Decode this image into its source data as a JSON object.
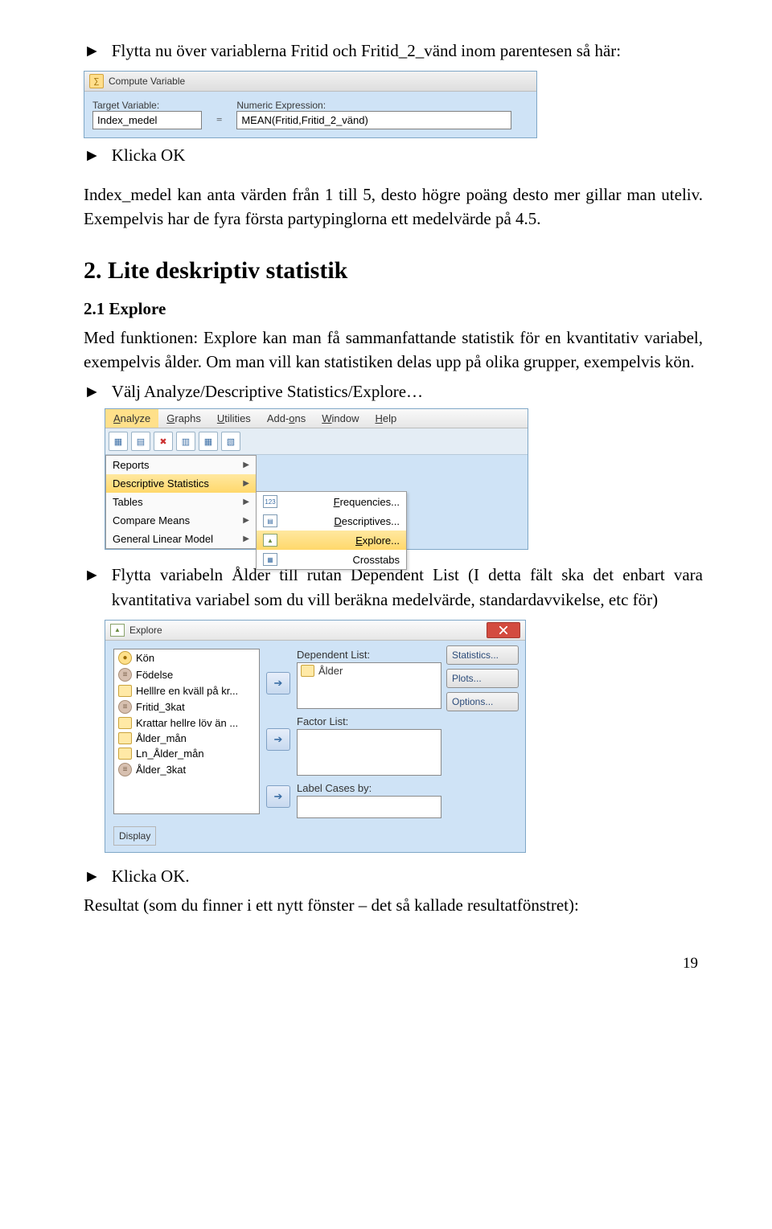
{
  "p1_prefix": "► ",
  "p1": "Flytta nu över variablerna Fritid och Fritid_2_vänd inom parentesen så här:",
  "compute": {
    "title": "Compute Variable",
    "target_label": "Target Variable:",
    "target_value": "Index_medel",
    "eq": "=",
    "expr_label": "Numeric Expression:",
    "expr_value": "MEAN(Fritid,Fritid_2_vänd)"
  },
  "p2_prefix": "► ",
  "p2": "Klicka OK",
  "p3": "Index_medel kan anta värden från 1 till 5, desto högre poäng desto mer gillar man uteliv. Exempelvis har de fyra första partypinglorna ett medelvärde på 4.5.",
  "h2": "2. Lite deskriptiv statistik",
  "h3": "2.1 Explore",
  "p4": "Med funktionen: Explore kan man få sammanfattande statistik för en kvantitativ variabel, exempelvis ålder. Om man vill kan statistiken delas upp på olika grupper, exempelvis kön.",
  "p5_prefix": "► ",
  "p5": "Välj Analyze/Descriptive Statistics/Explore…",
  "menu": {
    "items": [
      "Analyze",
      "Graphs",
      "Utilities",
      "Add-ons",
      "Window",
      "Help"
    ],
    "drop": [
      "Reports",
      "Descriptive Statistics",
      "Tables",
      "Compare Means",
      "General Linear Model"
    ],
    "sub": [
      "Frequencies...",
      "Descriptives...",
      "Explore...",
      "Crosstabs"
    ]
  },
  "p6_prefix": "► ",
  "p6": "Flytta variabeln Ålder till rutan Dependent List (I detta fält ska det enbart vara kvantitativa variabel som du vill beräkna medelvärde, standardavvikelse, etc för)",
  "explore": {
    "title": "Explore",
    "vars": [
      {
        "t": "nom",
        "n": "Kön"
      },
      {
        "t": "ord",
        "n": "Födelse"
      },
      {
        "t": "sca",
        "n": "Helllre en kväll på kr..."
      },
      {
        "t": "ord",
        "n": "Fritid_3kat"
      },
      {
        "t": "sca",
        "n": "Krattar hellre löv än ..."
      },
      {
        "t": "sca",
        "n": "Ålder_mån"
      },
      {
        "t": "sca",
        "n": "Ln_Ålder_mån"
      },
      {
        "t": "ord",
        "n": "Ålder_3kat"
      }
    ],
    "dep_label": "Dependent List:",
    "dep_value": "Ålder",
    "fac_label": "Factor List:",
    "lab_label": "Label Cases by:",
    "side": [
      "Statistics...",
      "Plots...",
      "Options..."
    ],
    "display": "Display"
  },
  "p7_prefix": "► ",
  "p7": "Klicka OK.",
  "p8": "Resultat (som du finner i ett nytt fönster – det så kallade resultatfönstret):",
  "pagenum": "19"
}
